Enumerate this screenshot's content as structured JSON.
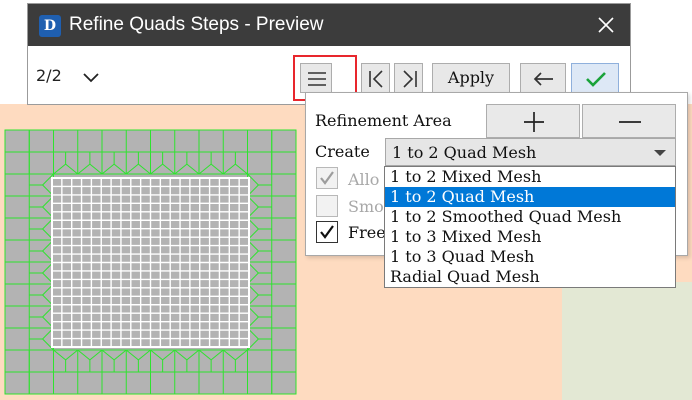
{
  "window": {
    "title": "Refine Quads Steps - Preview",
    "logo_text": "D",
    "logo_color": "#1f5fb0",
    "titlebar_color": "#3c3c3c"
  },
  "toolbar": {
    "step_counter": "2/2",
    "apply_label": "Apply",
    "menu_icon": "hamburger-icon",
    "first_icon": "skip-first-icon",
    "last_icon": "skip-last-icon",
    "back_icon": "arrow-left-icon",
    "confirm_icon": "checkmark-icon",
    "confirm_color": "#1aa33a",
    "highlight_color": "#e8262d"
  },
  "panel": {
    "refinement_area_label": "Refinement Area",
    "add_icon": "plus-icon",
    "remove_icon": "minus-icon",
    "create_label": "Create",
    "create_value": "1 to 2 Quad Mesh",
    "checkboxes": [
      {
        "label": "Allo",
        "checked": true,
        "enabled": false
      },
      {
        "label": "Smoo",
        "checked": false,
        "enabled": false
      },
      {
        "label": "Free",
        "checked": true,
        "enabled": true
      }
    ]
  },
  "dropdown": {
    "options": [
      "1 to 2 Mixed Mesh",
      "1 to 2 Quad Mesh",
      "1 to 2 Smoothed Quad Mesh",
      "1 to 3 Mixed Mesh",
      "1 to 3 Quad Mesh",
      "Radial Quad Mesh"
    ],
    "selected_index": 1,
    "selected_color": "#0078d7"
  },
  "viewport": {
    "background_color": "#fedbc0",
    "secondary_color": "#e3e8d4",
    "mesh_fill_color": "#b3b3b3",
    "mesh_line_color": "#2ee32e",
    "inner_line_color": "#ffffff"
  }
}
